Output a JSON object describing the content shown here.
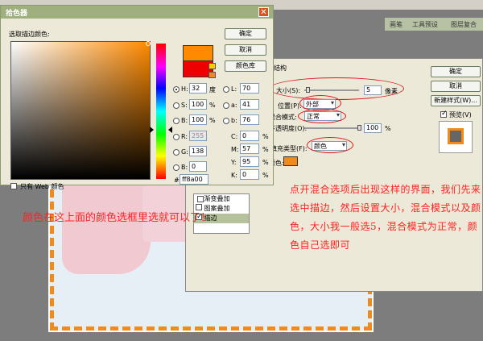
{
  "picker": {
    "title": "拾色器",
    "field_label": "选取描边颜色:",
    "ok": "确定",
    "cancel": "取消",
    "color_library": "颜色库",
    "hsb": [
      {
        "label": "H:",
        "value": "32",
        "unit": "度",
        "selected": true
      },
      {
        "label": "S:",
        "value": "100",
        "unit": "%",
        "selected": false
      },
      {
        "label": "B:",
        "value": "100",
        "unit": "%",
        "selected": false
      }
    ],
    "rgb": [
      {
        "label": "R:",
        "value": "255",
        "disabled": true
      },
      {
        "label": "G:",
        "value": "138",
        "disabled": false
      },
      {
        "label": "B:",
        "value": "0",
        "disabled": false
      }
    ],
    "lab": [
      {
        "label": "L:",
        "value": "70"
      },
      {
        "label": "a:",
        "value": "41"
      },
      {
        "label": "b:",
        "value": "76"
      }
    ],
    "cmyk": [
      {
        "label": "C:",
        "value": "0",
        "unit": "%"
      },
      {
        "label": "M:",
        "value": "57",
        "unit": "%"
      },
      {
        "label": "Y:",
        "value": "95",
        "unit": "%"
      },
      {
        "label": "K:",
        "value": "0",
        "unit": "%"
      }
    ],
    "hex_label": "#",
    "hex_value": "ff8a00",
    "web_only_label": "只有 Web 颜色"
  },
  "stroke": {
    "group_title": "结构",
    "size_label": "大小(S):",
    "size_value": "5",
    "size_unit": "像素",
    "position_label": "位置(P):",
    "position_value": "外部",
    "blend_label": "混合模式:",
    "blend_value": "正常",
    "opacity_label": "不透明度(O):",
    "opacity_value": "100",
    "opacity_unit": "%",
    "fill_label": "填充类型(F):",
    "fill_value": "颜色",
    "color_label": "颜色:"
  },
  "style_list": [
    {
      "label": "渐变叠加",
      "checked": false,
      "active": false
    },
    {
      "label": "图案叠加",
      "checked": false,
      "active": false
    },
    {
      "label": "描边",
      "checked": true,
      "active": true
    }
  ],
  "layer_style_dialog": {
    "ok": "确定",
    "cancel": "取消",
    "new_style": "新建样式(W)...",
    "preview_label": "预览(V)",
    "preview_checked": true
  },
  "palette_tabs": [
    "画笔",
    "工具预设",
    "图层复合"
  ],
  "annotations": {
    "left": "颜色在这上面的颜色选框里选就可以了！",
    "right": "点开混合选项后出现这样的界面，我们先来选中描边，然后设置大小，混合模式以及颜色，大小我一般选5，混合模式为正常，颜色自己选即可"
  },
  "colors": {
    "selected_new": "#ff8a00",
    "current_old": "#ee0000",
    "stroke_orange": "#f08a1a",
    "annotation_red": "#ff2222"
  }
}
